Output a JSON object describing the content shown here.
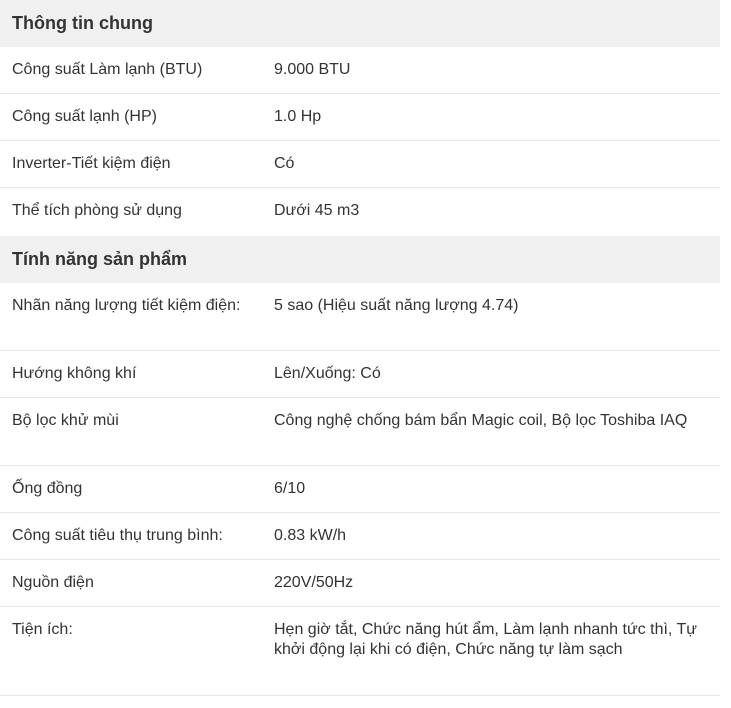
{
  "sections": [
    {
      "title": "Thông tin chung",
      "rows": [
        {
          "label": "Công suất Làm lạnh (BTU)",
          "value": "9.000 BTU"
        },
        {
          "label": "Công suất lạnh (HP)",
          "value": "1.0 Hp"
        },
        {
          "label": "Inverter-Tiết kiệm điện",
          "value": "Có"
        },
        {
          "label": "Thể tích phòng sử dụng",
          "value": "Dưới 45 m3"
        }
      ]
    },
    {
      "title": "Tính năng sản phẩm",
      "rows": [
        {
          "label": "Nhãn năng lượng tiết kiệm điện:",
          "value": "5 sao (Hiệu suất năng lượng 4.74)"
        },
        {
          "label": "Hướng không khí",
          "value": "Lên/Xuống: Có"
        },
        {
          "label": "Bộ lọc khử mùi",
          "value": "Công nghệ chống bám bẩn Magic coil, Bộ lọc Toshiba IAQ"
        },
        {
          "label": "Ống đồng",
          "value": "6/10"
        },
        {
          "label": "Công suất tiêu thụ trung bình:",
          "value": "0.83 kW/h"
        },
        {
          "label": "Nguồn điện",
          "value": "220V/50Hz"
        },
        {
          "label": "Tiện ích:",
          "value": "Hẹn giờ tắt, Chức năng hút ẩm, Làm lạnh nhanh tức thì, Tự khởi động lại khi có điện, Chức năng tự làm sạch"
        }
      ]
    }
  ]
}
